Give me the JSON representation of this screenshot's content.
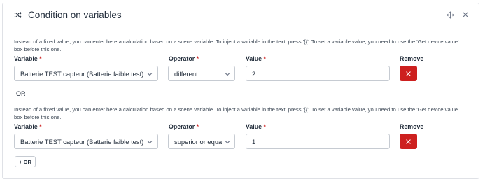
{
  "card": {
    "title": "Condition on variables",
    "header_icon": "shuffle-icon",
    "move_icon": "move-icon",
    "close_icon": "close-icon"
  },
  "help_text": "Instead of a fixed value, you can enter here a calculation based on a scene variable. To inject a variable in the text, press '{{'. To set a variable value, you need to use the 'Get device value' box before this one.",
  "labels": {
    "variable": "Variable",
    "operator": "Operator",
    "value": "Value",
    "remove": "Remove",
    "required_mark": "*"
  },
  "conditions": [
    {
      "variable": "Batterie TEST capteur (Batterie faible test)",
      "operator": "different",
      "value": "2"
    },
    {
      "variable": "Batterie TEST capteur (Batterie faible test)",
      "operator": "superior or equal",
      "value": "1"
    }
  ],
  "or_separator": "OR",
  "add_or_button": "+ OR",
  "colors": {
    "danger": "#cd201f",
    "text": "#232e3c",
    "border": "#c6cbd2"
  }
}
